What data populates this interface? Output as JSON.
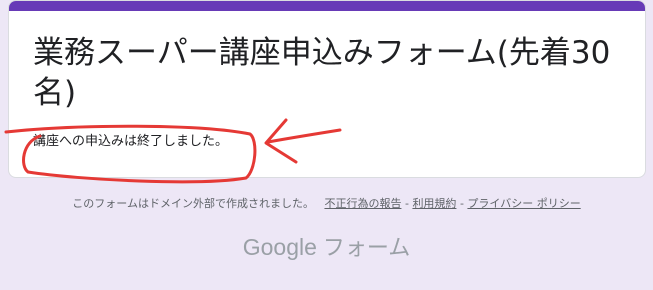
{
  "form": {
    "title": "業務スーパー講座申込みフォーム(先着30名)",
    "closed_message": "講座への申込みは終了しました。"
  },
  "footer": {
    "note": "このフォームはドメイン外部で作成されました。",
    "report_link": "不正行為の報告",
    "separator": "-",
    "terms_link": "利用規約",
    "privacy_link": "プライバシー ポリシー"
  },
  "brand": {
    "logo": "Google",
    "product": "フォーム"
  },
  "colors": {
    "page_background": "#ede7f6",
    "accent": "#673ab7",
    "annotation": "#e53935"
  }
}
